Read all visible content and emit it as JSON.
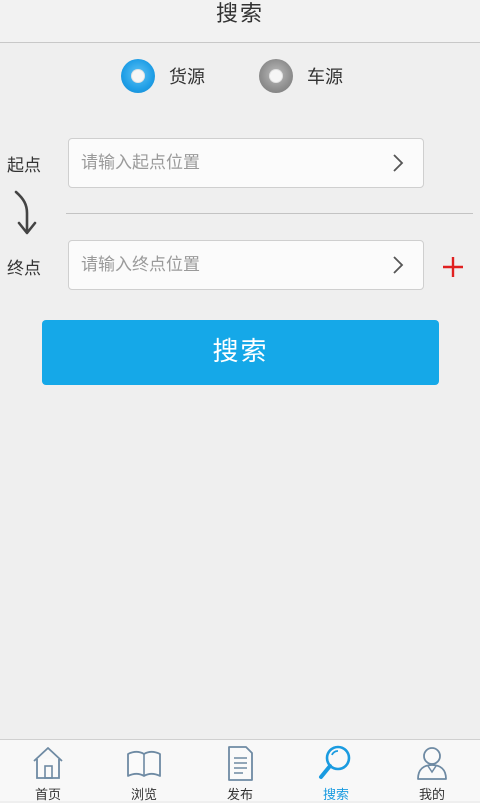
{
  "header": {
    "title": "搜索"
  },
  "source_type": {
    "options": [
      {
        "label": "货源",
        "selected": true
      },
      {
        "label": "车源",
        "selected": false
      }
    ]
  },
  "origin": {
    "label": "起点",
    "placeholder": "请输入起点位置"
  },
  "destination": {
    "label": "终点",
    "placeholder": "请输入终点位置"
  },
  "search_button": {
    "label": "搜索"
  },
  "bottom_nav": {
    "items": [
      {
        "label": "首页",
        "icon": "home-icon",
        "active": false
      },
      {
        "label": "浏览",
        "icon": "book-icon",
        "active": false
      },
      {
        "label": "发布",
        "icon": "document-icon",
        "active": false
      },
      {
        "label": "搜索",
        "icon": "search-icon",
        "active": true
      },
      {
        "label": "我的",
        "icon": "user-icon",
        "active": false
      }
    ]
  },
  "colors": {
    "accent": "#15a8e8",
    "active_nav": "#1a9be0",
    "add_icon": "#e02020",
    "background": "#efefef"
  }
}
